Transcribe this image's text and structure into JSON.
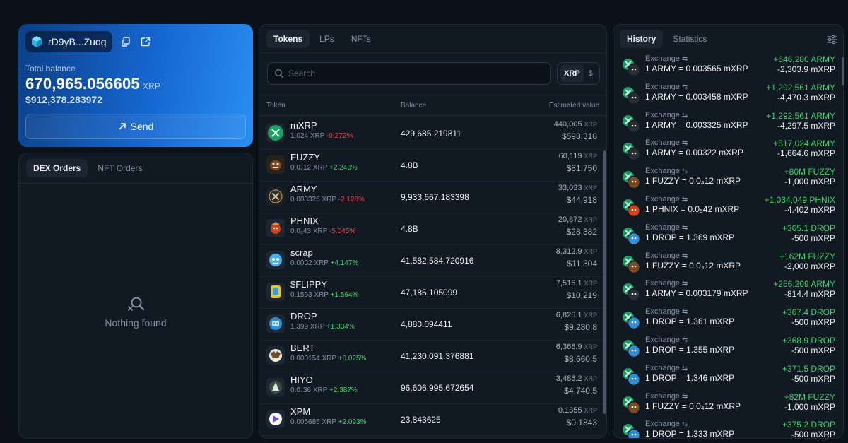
{
  "wallet": {
    "address": "rD9yB...Zuog",
    "total_balance_label": "Total balance",
    "balance": "670,965.056605",
    "balance_unit": "XRP",
    "usd_value": "$912,378.283972",
    "send_label": "Send"
  },
  "orders": {
    "tabs": [
      {
        "label": "DEX Orders",
        "active": true
      },
      {
        "label": "NFT Orders",
        "active": false
      }
    ],
    "empty_text": "Nothing found"
  },
  "tokens": {
    "tabs": [
      {
        "label": "Tokens",
        "active": true
      },
      {
        "label": "LPs",
        "active": false
      },
      {
        "label": "NFTs",
        "active": false
      }
    ],
    "search_placeholder": "Search",
    "currency_options": [
      {
        "label": "XRP",
        "active": true
      },
      {
        "label": "$",
        "active": false
      }
    ],
    "headers": {
      "token": "Token",
      "balance": "Balance",
      "estimated_value": "Estimated value"
    },
    "rows": [
      {
        "name": "mXRP",
        "price": "1.024 XRP",
        "change": "-0.272%",
        "positive": false,
        "balance": "429,685.219811",
        "xrp_value": "440,005",
        "xrp_unit": "XRP",
        "usd_value": "$598,318",
        "icon": "mxrp-icon",
        "color": "#1e9e63"
      },
      {
        "name": "FUZZY",
        "price": "0.0₄12 XRP",
        "change": "+2.246%",
        "positive": true,
        "balance": "4.8B",
        "xrp_value": "60,119",
        "xrp_unit": "XRP",
        "usd_value": "$81,750",
        "icon": "fuzzy-icon",
        "color": "#7a4a22"
      },
      {
        "name": "ARMY",
        "price": "0.003325 XRP",
        "change": "-2.128%",
        "positive": false,
        "balance": "9,933,667.183398",
        "xrp_value": "33,033",
        "xrp_unit": "XRP",
        "usd_value": "$44,918",
        "icon": "army-icon",
        "color": "#2a2e33"
      },
      {
        "name": "PHNIX",
        "price": "0.0₅43 XRP",
        "change": "-5.045%",
        "positive": false,
        "balance": "4.8B",
        "xrp_value": "20,872",
        "xrp_unit": "XRP",
        "usd_value": "$28,382",
        "icon": "phnix-icon",
        "color": "#d0401c"
      },
      {
        "name": "scrap",
        "price": "0.0002 XRP",
        "change": "+4.147%",
        "positive": true,
        "balance": "41,582,584.720916",
        "xrp_value": "8,312.9",
        "xrp_unit": "XRP",
        "usd_value": "$11,304",
        "icon": "scrap-icon",
        "color": "#4ab3e6"
      },
      {
        "name": "$FLIPPY",
        "price": "0.1593 XRP",
        "change": "+1.564%",
        "positive": true,
        "balance": "47,185.105099",
        "xrp_value": "7,515.1",
        "xrp_unit": "XRP",
        "usd_value": "$10,219",
        "icon": "flippy-icon",
        "color": "#e6c634"
      },
      {
        "name": "DROP",
        "price": "1.399 XRP",
        "change": "+1.334%",
        "positive": true,
        "balance": "4,880.094411",
        "xrp_value": "6,825.1",
        "xrp_unit": "XRP",
        "usd_value": "$9,280.8",
        "icon": "drop-icon",
        "color": "#2f8fd6"
      },
      {
        "name": "BERT",
        "price": "0.000154 XRP",
        "change": "+0.025%",
        "positive": true,
        "balance": "41,230,091.376881",
        "xrp_value": "6,368.9",
        "xrp_unit": "XRP",
        "usd_value": "$8,660.5",
        "icon": "bert-icon",
        "color": "#e9e4da"
      },
      {
        "name": "HIYO",
        "price": "0.0₄36 XRP",
        "change": "+2.387%",
        "positive": true,
        "balance": "96,606,995.672654",
        "xrp_value": "3,486.2",
        "xrp_unit": "XRP",
        "usd_value": "$4,740.5",
        "icon": "hiyo-icon",
        "color": "#3a4a3e"
      },
      {
        "name": "XPM",
        "price": "0.005685 XRP",
        "change": "+2.093%",
        "positive": true,
        "balance": "23.843625",
        "xrp_value": "0.1355",
        "xrp_unit": "XRP",
        "usd_value": "$0.1843",
        "icon": "xpm-icon",
        "color": "#6b4de6"
      }
    ]
  },
  "history": {
    "tabs": [
      {
        "label": "History",
        "active": true
      },
      {
        "label": "Statistics",
        "active": false
      }
    ],
    "items": [
      {
        "type": "Exchange",
        "rate": "1 ARMY = 0.003565 mXRP",
        "received": "+646,280 ARMY",
        "sent": "-2,303.9 mXRP",
        "icon": "army-mxrp-icon",
        "color": "#2a2e33"
      },
      {
        "type": "Exchange",
        "rate": "1 ARMY = 0.003458 mXRP",
        "received": "+1,292,561 ARMY",
        "sent": "-4,470.3 mXRP",
        "icon": "army-mxrp-icon",
        "color": "#2a2e33"
      },
      {
        "type": "Exchange",
        "rate": "1 ARMY = 0.003325 mXRP",
        "received": "+1,292,561 ARMY",
        "sent": "-4,297.5 mXRP",
        "icon": "army-mxrp-icon",
        "color": "#2a2e33"
      },
      {
        "type": "Exchange",
        "rate": "1 ARMY = 0.00322 mXRP",
        "received": "+517,024 ARMY",
        "sent": "-1,664.6 mXRP",
        "icon": "army-mxrp-icon",
        "color": "#2a2e33"
      },
      {
        "type": "Exchange",
        "rate": "1 FUZZY = 0.0₄12 mXRP",
        "received": "+80M FUZZY",
        "sent": "-1,000 mXRP",
        "icon": "fuzzy-mxrp-icon",
        "color": "#7a4a22"
      },
      {
        "type": "Exchange",
        "rate": "1 PHNIX = 0.0₅42 mXRP",
        "received": "+1,034,049 PHNIX",
        "sent": "-4.402 mXRP",
        "icon": "phnix-mxrp-icon",
        "color": "#d0401c"
      },
      {
        "type": "Exchange",
        "rate": "1 DROP = 1.369 mXRP",
        "received": "+365.1 DROP",
        "sent": "-500 mXRP",
        "icon": "drop-mxrp-icon",
        "color": "#2f8fd6"
      },
      {
        "type": "Exchange",
        "rate": "1 FUZZY = 0.0₄12 mXRP",
        "received": "+162M FUZZY",
        "sent": "-2,000 mXRP",
        "icon": "fuzzy-mxrp-icon",
        "color": "#7a4a22"
      },
      {
        "type": "Exchange",
        "rate": "1 ARMY = 0.003179 mXRP",
        "received": "+256,209 ARMY",
        "sent": "-814.4 mXRP",
        "icon": "army-mxrp-icon",
        "color": "#2a2e33"
      },
      {
        "type": "Exchange",
        "rate": "1 DROP = 1.361 mXRP",
        "received": "+367.4 DROP",
        "sent": "-500 mXRP",
        "icon": "drop-mxrp-icon",
        "color": "#2f8fd6"
      },
      {
        "type": "Exchange",
        "rate": "1 DROP = 1.355 mXRP",
        "received": "+368.9 DROP",
        "sent": "-500 mXRP",
        "icon": "drop-mxrp-icon",
        "color": "#2f8fd6"
      },
      {
        "type": "Exchange",
        "rate": "1 DROP = 1.346 mXRP",
        "received": "+371.5 DROP",
        "sent": "-500 mXRP",
        "icon": "drop-mxrp-icon",
        "color": "#2f8fd6"
      },
      {
        "type": "Exchange",
        "rate": "1 FUZZY = 0.0₄12 mXRP",
        "received": "+82M FUZZY",
        "sent": "-1,000 mXRP",
        "icon": "fuzzy-mxrp-icon",
        "color": "#7a4a22"
      },
      {
        "type": "Exchange",
        "rate": "1 DROP = 1.333 mXRP",
        "received": "+375.2 DROP",
        "sent": "-500 mXRP",
        "icon": "drop-mxrp-icon",
        "color": "#2f8fd6"
      }
    ]
  },
  "colors": {
    "accent": "#1566cf",
    "positive": "#3fd26b",
    "negative": "#ee4a4a",
    "mxrp": "#1e9e63"
  }
}
